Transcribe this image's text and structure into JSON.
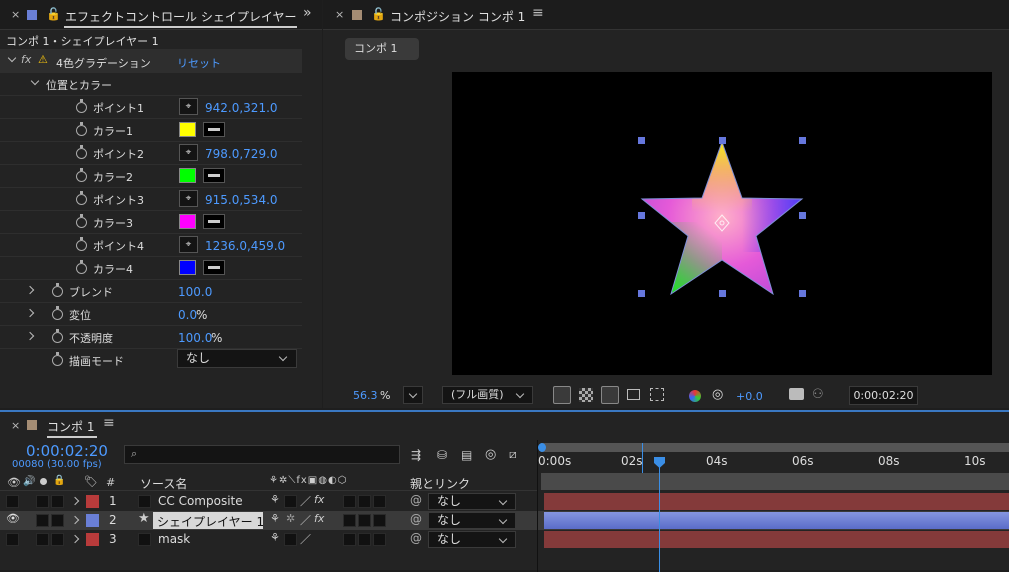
{
  "effect_panel": {
    "title": "エフェクトコントロール シェイプレイヤー",
    "subtitle": "コンポ 1・シェイプレイヤー 1",
    "effect_name": "4色グラデーション",
    "reset": "リセット",
    "group": "位置とカラー",
    "rows": [
      {
        "label": "ポイント1",
        "type": "point",
        "value": "942.0,321.0"
      },
      {
        "label": "カラー1",
        "type": "color",
        "color": "#ffff00"
      },
      {
        "label": "ポイント2",
        "type": "point",
        "value": "798.0,729.0"
      },
      {
        "label": "カラー2",
        "type": "color",
        "color": "#00ff00"
      },
      {
        "label": "ポイント3",
        "type": "point",
        "value": "915.0,534.0"
      },
      {
        "label": "カラー3",
        "type": "color",
        "color": "#ff00ff"
      },
      {
        "label": "ポイント4",
        "type": "point",
        "value": "1236.0,459.0"
      },
      {
        "label": "カラー4",
        "type": "color",
        "color": "#0000ff"
      }
    ],
    "blend": {
      "label": "ブレンド",
      "value": "100.0"
    },
    "jitter": {
      "label": "変位",
      "value": "0.0",
      "unit": "%"
    },
    "opacity": {
      "label": "不透明度",
      "value": "100.0",
      "unit": "%"
    },
    "blend_mode": {
      "label": "描画モード",
      "value": "なし"
    }
  },
  "comp_panel": {
    "title": "コンポジション コンポ 1",
    "tab_chip": "コンポ 1",
    "zoom": "56.3",
    "zoom_unit": "%",
    "quality": "(フル画質)",
    "exposure": "+0.0",
    "timecode": "0:00:02:20"
  },
  "timeline": {
    "tab": "コンポ 1",
    "timecode": "0:00:02:20",
    "frames": "00080 (30.00 fps)",
    "search_placeholder": "",
    "col_source": "ソース名",
    "col_num": "#",
    "col_parent": "親とリンク",
    "ruler": [
      "0:00s",
      "02s",
      "04s",
      "06s",
      "08s",
      "10s"
    ],
    "layers": [
      {
        "num": "1",
        "name": "CC Composite",
        "color": "#b83b3b",
        "parent": "なし",
        "fx": true
      },
      {
        "num": "2",
        "name": "シェイプレイヤー 1",
        "color": "#6a7fd6",
        "parent": "なし",
        "fx": true
      },
      {
        "num": "3",
        "name": "mask",
        "color": "#b83b3b",
        "parent": "なし",
        "fx": false
      }
    ]
  }
}
